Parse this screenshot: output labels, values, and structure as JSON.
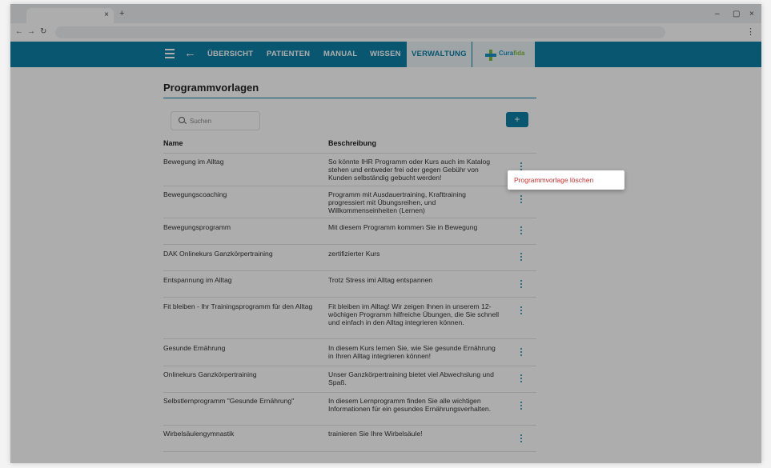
{
  "browser": {
    "tab_close": "×",
    "new_tab": "+",
    "back": "←",
    "forward": "→",
    "reload": "↻",
    "minimize": "–",
    "restore": "▢",
    "close": "×",
    "menu": "⋮"
  },
  "header": {
    "back_icon": "←",
    "nav": [
      "ÜBERSICHT",
      "PATIENTEN",
      "MANUAL",
      "WISSEN",
      "VERWALTUNG"
    ],
    "active_nav": "VERWALTUNG",
    "logo": {
      "cura": "Cura",
      "fida": "fida"
    },
    "colors": {
      "primary": "#0d7fa5",
      "logo_blue": "#1a8fc4",
      "logo_green": "#7fb93a"
    }
  },
  "page": {
    "title": "Programmvorlagen",
    "search_placeholder": "Suchen",
    "add_label": "+",
    "columns": {
      "name": "Name",
      "description": "Beschreibung"
    },
    "rows": [
      {
        "name": "Bewegung im Alltag",
        "description": "So könnte IHR Programm oder Kurs auch im Katalog stehen und entweder frei oder gegen Gebühr von Kunden selbständig gebucht werden!"
      },
      {
        "name": "Bewegungscoaching",
        "description": "Programm mit Ausdauertraining, Krafttraining progressiert mit Übungsreihen, und Willkommenseinheiten (Lernen)"
      },
      {
        "name": "Bewegungsprogramm",
        "description": "Mit diesem Programm kommen Sie in Bewegung"
      },
      {
        "name": "DAK Onlinekurs Ganzkörpertraining",
        "description": "zertifizierter Kurs"
      },
      {
        "name": "Entspannung im Alltag",
        "description": "Trotz Stress imi Alltag entspannen"
      },
      {
        "name": "Fit bleiben - Ihr Trainingsprogramm für den Alltag",
        "description": "Fit bleiben im Alltag! Wir zeigen Ihnen in unserem 12-wöchigen Programm hilfreiche Übungen, die Sie schnell und einfach in den Alltag integrieren können."
      },
      {
        "name": "Gesunde Ernährung",
        "description": "In diesem Kurs lernen Sie, wie Sie gesunde Ernährung in Ihren Alltag integrieren können!"
      },
      {
        "name": "Onlinekurs Ganzkörpertraining",
        "description": "Unser Ganzkörpertraining bietet viel Abwechslung und Spaß."
      },
      {
        "name": "Selbstlernprogramm \"Gesunde Ernährung\"",
        "description": "In diesem Lernprogramm finden Sie alle wichtigen Informationen für ein gesundes Ernährungsverhalten."
      },
      {
        "name": "Wirbelsäulengymnastik",
        "description": "trainieren Sie Ihre Wirbelsäule!"
      }
    ]
  },
  "context_menu": {
    "delete_label": "Programmvorlage löschen",
    "color": "#d32f2f"
  }
}
